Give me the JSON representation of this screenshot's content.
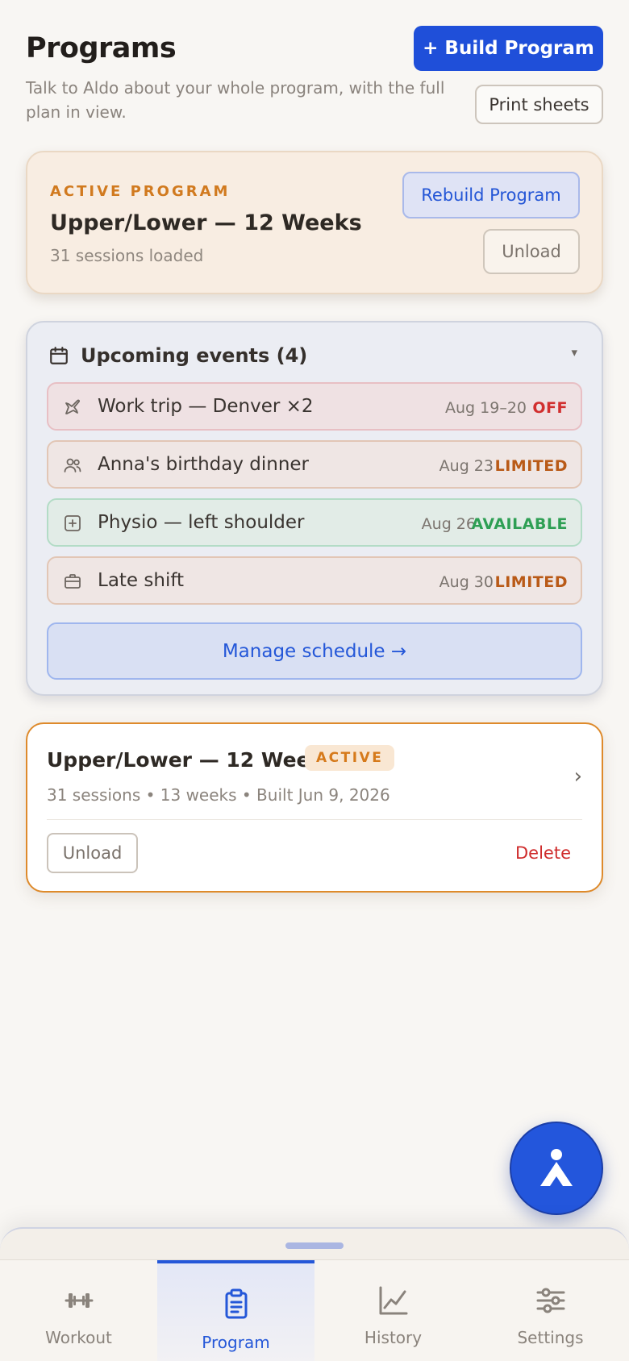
{
  "header": {
    "title": "Programs",
    "subtitle": "Talk to Aldo about your whole program, with the full plan in view.",
    "build_button": "+ Build Program",
    "print_button": "Print sheets"
  },
  "active_program": {
    "kicker": "ACTIVE PROGRAM",
    "name": "Upper/Lower — 12 Weeks",
    "sessions": "31 sessions loaded",
    "rebuild_button": "Rebuild Program",
    "unload_button": "Unload"
  },
  "events": {
    "title": "Upcoming events (4)",
    "caret": "▾",
    "items": [
      {
        "icon": "plane-icon",
        "name": "Work trip — Denver ×2",
        "date": "Aug 19–20",
        "status": "OFF"
      },
      {
        "icon": "people-icon",
        "name": "Anna's birthday dinner",
        "date": "Aug 23",
        "status": "LIMITED"
      },
      {
        "icon": "medical-plus-icon",
        "name": "Physio — left shoulder",
        "date": "Aug 26",
        "status": "AVAILABLE"
      },
      {
        "icon": "briefcase-icon",
        "name": "Late shift",
        "date": "Aug 30",
        "status": "LIMITED"
      }
    ],
    "manage_button": "Manage schedule →"
  },
  "program_list": [
    {
      "name": "Upper/Lower — 12 Weeks",
      "badge": "ACTIVE",
      "meta": "31 sessions • 13 weeks • Built Jun 9, 2026",
      "chevron": "›",
      "unload_button": "Unload",
      "delete_button": "Delete"
    }
  ],
  "nav": {
    "items": [
      {
        "label": "Workout",
        "icon": "dumbbell-icon"
      },
      {
        "label": "Program",
        "icon": "clipboard-icon"
      },
      {
        "label": "History",
        "icon": "chart-icon"
      },
      {
        "label": "Settings",
        "icon": "sliders-icon"
      }
    ],
    "active": "Program"
  },
  "colors": {
    "accent": "#1f4fd9",
    "active_orange": "#d17a1f",
    "off_red": "#d12f2f",
    "limited_orange": "#b95a17",
    "available_green": "#2e9f54"
  }
}
